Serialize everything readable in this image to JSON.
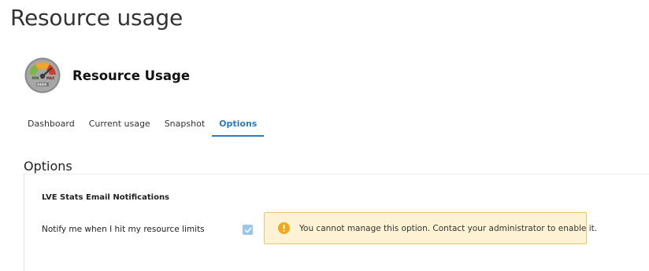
{
  "page": {
    "title": "Resource usage"
  },
  "app": {
    "name": "Resource Usage",
    "icon": "gauge-icon",
    "icon_labels": {
      "min": "MIN",
      "max": "MAX"
    }
  },
  "tabs": [
    {
      "label": "Dashboard",
      "active": false
    },
    {
      "label": "Current usage",
      "active": false
    },
    {
      "label": "Snapshot",
      "active": false
    },
    {
      "label": "Options",
      "active": true
    }
  ],
  "section": {
    "title": "Options"
  },
  "options": {
    "group_title": "LVE Stats Email Notifications",
    "notify": {
      "label": "Notify me when I hit my resource limits",
      "checked": true,
      "disabled": true
    },
    "warning": {
      "icon": "exclamation-icon",
      "text": "You cannot manage this option. Contact your administrator to enable it."
    }
  },
  "colors": {
    "accent": "#2a7ac4",
    "warning_bg": "#fdf3d4",
    "warning_border": "#e8c96a",
    "warning_icon": "#f0a81c",
    "checkbox_disabled": "#9cc5ea"
  }
}
